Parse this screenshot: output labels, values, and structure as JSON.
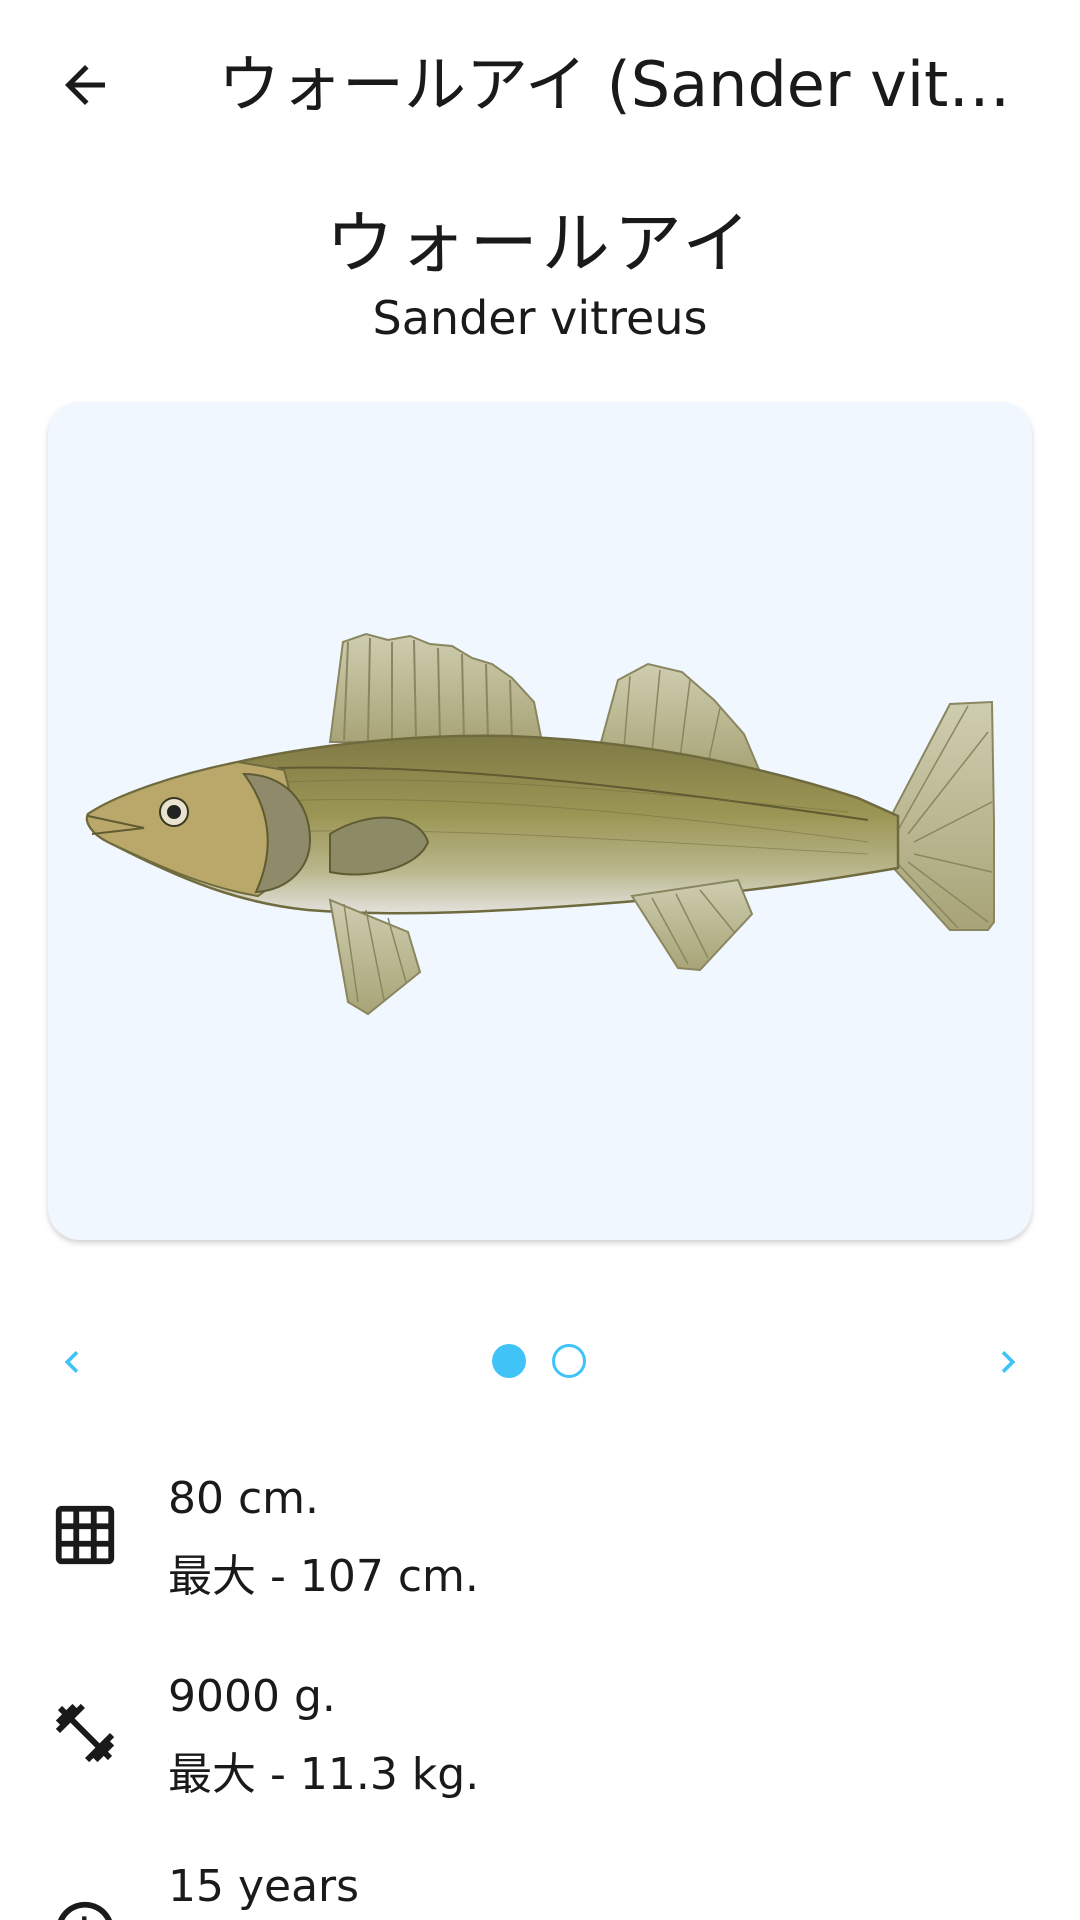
{
  "appbar": {
    "title": "ウォールアイ (Sander vitreus)"
  },
  "fish": {
    "common_name": "ウォールアイ",
    "scientific_name": "Sander vitreus"
  },
  "gallery": {
    "total_images": 2,
    "current_index": 1
  },
  "stats": {
    "length": {
      "icon": "grid-icon",
      "value": "80 cm.",
      "max": "最大 - 107 cm."
    },
    "weight": {
      "icon": "dumbbell-icon",
      "value": "9000 g.",
      "max": "最大 - 11.3 kg."
    },
    "age": {
      "icon": "clock-icon",
      "value": "15 years"
    }
  },
  "colors": {
    "accent": "#40c3f7",
    "card_background": "#f1f7fe"
  }
}
